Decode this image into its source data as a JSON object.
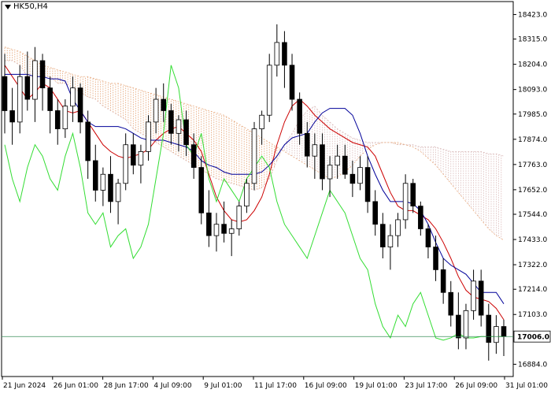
{
  "chart_data": {
    "type": "candlestick",
    "title": "HK50,H4",
    "current_price_label": "17006.0",
    "current_price": 17006.0,
    "ylim": [
      16830,
      18480
    ],
    "y_ticks": [
      "18423.0",
      "18315.0",
      "18204.0",
      "18093.0",
      "17985.0",
      "17874.0",
      "17763.0",
      "17652.0",
      "17544.0",
      "17433.0",
      "17322.0",
      "17214.0",
      "17103.0",
      "16884.0"
    ],
    "x_tick_labels": [
      "21 Jun 2024",
      "26 Jun 01:00",
      "28 Jun 17:00",
      "4 Jul 09:00",
      "9 Jul 01:00",
      "11 Jul 17:00",
      "16 Jul 09:00",
      "19 Jul 01:00",
      "23 Jul 17:00",
      "26 Jul 09:00",
      "31 Jul 01:00"
    ],
    "candles": [
      [
        18150,
        18250,
        17900,
        18000
      ],
      [
        18000,
        18100,
        17850,
        17950
      ],
      [
        17950,
        18200,
        17900,
        18150
      ],
      [
        18150,
        18260,
        18000,
        18050
      ],
      [
        18050,
        18280,
        17950,
        18220
      ],
      [
        18220,
        18250,
        18000,
        18100
      ],
      [
        18100,
        18150,
        17900,
        18000
      ],
      [
        18000,
        18050,
        17850,
        17920
      ],
      [
        17920,
        18050,
        17880,
        18020
      ],
      [
        18020,
        18150,
        17950,
        18100
      ],
      [
        18100,
        18120,
        17900,
        17950
      ],
      [
        17950,
        18000,
        17700,
        17780
      ],
      [
        17780,
        17850,
        17600,
        17650
      ],
      [
        17650,
        17750,
        17580,
        17720
      ],
      [
        17720,
        17800,
        17550,
        17600
      ],
      [
        17600,
        17700,
        17500,
        17680
      ],
      [
        17680,
        17900,
        17650,
        17850
      ],
      [
        17850,
        17900,
        17720,
        17760
      ],
      [
        17760,
        17850,
        17680,
        17820
      ],
      [
        17820,
        17980,
        17780,
        17950
      ],
      [
        17950,
        18100,
        17900,
        18050
      ],
      [
        18050,
        18120,
        17950,
        18000
      ],
      [
        18000,
        18030,
        17850,
        17900
      ],
      [
        17900,
        17980,
        17820,
        17960
      ],
      [
        17960,
        18000,
        17800,
        17850
      ],
      [
        17850,
        17900,
        17700,
        17750
      ],
      [
        17750,
        17800,
        17500,
        17550
      ],
      [
        17550,
        17650,
        17400,
        17450
      ],
      [
        17450,
        17550,
        17380,
        17500
      ],
      [
        17500,
        17600,
        17420,
        17460
      ],
      [
        17460,
        17520,
        17360,
        17480
      ],
      [
        17480,
        17600,
        17450,
        17580
      ],
      [
        17580,
        17700,
        17550,
        17680
      ],
      [
        17680,
        17950,
        17650,
        17920
      ],
      [
        17920,
        18000,
        17850,
        17980
      ],
      [
        17980,
        18250,
        17950,
        18200
      ],
      [
        18200,
        18380,
        18150,
        18300
      ],
      [
        18300,
        18350,
        18100,
        18200
      ],
      [
        18200,
        18250,
        18000,
        18050
      ],
      [
        18050,
        18080,
        17850,
        17900
      ],
      [
        17900,
        17950,
        17750,
        17800
      ],
      [
        17800,
        17900,
        17700,
        17850
      ],
      [
        17850,
        17900,
        17650,
        17700
      ],
      [
        17700,
        17800,
        17620,
        17760
      ],
      [
        17760,
        17850,
        17700,
        17800
      ],
      [
        17800,
        17850,
        17700,
        17720
      ],
      [
        17720,
        17780,
        17620,
        17680
      ],
      [
        17680,
        17800,
        17650,
        17750
      ],
      [
        17750,
        17800,
        17550,
        17600
      ],
      [
        17600,
        17650,
        17450,
        17500
      ],
      [
        17500,
        17550,
        17350,
        17400
      ],
      [
        17400,
        17500,
        17300,
        17450
      ],
      [
        17450,
        17550,
        17400,
        17520
      ],
      [
        17520,
        17720,
        17480,
        17680
      ],
      [
        17680,
        17700,
        17550,
        17580
      ],
      [
        17580,
        17600,
        17450,
        17480
      ],
      [
        17480,
        17500,
        17350,
        17400
      ],
      [
        17400,
        17450,
        17250,
        17300
      ],
      [
        17300,
        17350,
        17150,
        17200
      ],
      [
        17200,
        17250,
        17050,
        17100
      ],
      [
        17100,
        17200,
        16950,
        17000
      ],
      [
        17000,
        17150,
        16950,
        17120
      ],
      [
        17120,
        17300,
        17080,
        17250
      ],
      [
        17250,
        17300,
        17050,
        17100
      ],
      [
        17100,
        17150,
        16900,
        16980
      ],
      [
        16980,
        17100,
        16930,
        17050
      ],
      [
        17050,
        17080,
        16920,
        17006
      ]
    ],
    "series": [
      {
        "color": "#cc0000",
        "values": [
          18200,
          18150,
          18100,
          18050,
          18080,
          18120,
          18100,
          18050,
          18000,
          17990,
          18000,
          17950,
          17900,
          17850,
          17820,
          17800,
          17790,
          17800,
          17810,
          17830,
          17870,
          17900,
          17920,
          17930,
          17900,
          17870,
          17820,
          17720,
          17620,
          17560,
          17520,
          17510,
          17520,
          17560,
          17620,
          17720,
          17850,
          17950,
          18020,
          18050,
          18020,
          17980,
          17950,
          17920,
          17900,
          17880,
          17860,
          17850,
          17840,
          17800,
          17720,
          17640,
          17580,
          17560,
          17560,
          17540,
          17520,
          17480,
          17420,
          17350,
          17270,
          17210,
          17180,
          17170,
          17160,
          17130,
          17080
        ]
      },
      {
        "color": "#000099",
        "values": [
          18160,
          18160,
          18160,
          18160,
          18150,
          18150,
          18140,
          18140,
          18130,
          18050,
          18000,
          17950,
          17930,
          17930,
          17930,
          17930,
          17920,
          17900,
          17880,
          17870,
          17870,
          17870,
          17860,
          17850,
          17840,
          17820,
          17780,
          17760,
          17750,
          17730,
          17720,
          17720,
          17720,
          17720,
          17730,
          17760,
          17800,
          17850,
          17880,
          17890,
          17900,
          17950,
          17990,
          18010,
          18010,
          18010,
          17980,
          17900,
          17800,
          17720,
          17650,
          17600,
          17600,
          17600,
          17590,
          17560,
          17500,
          17420,
          17350,
          17320,
          17300,
          17280,
          17240,
          17200,
          17200,
          17200,
          17150
        ]
      },
      {
        "color": "#33dd33",
        "values": [
          17850,
          17700,
          17600,
          17750,
          17850,
          17800,
          17700,
          17650,
          17800,
          17900,
          17750,
          17550,
          17500,
          17550,
          17400,
          17450,
          17480,
          17350,
          17400,
          17500,
          17700,
          17900,
          18200,
          18100,
          17850,
          17800,
          17900,
          17700,
          17600,
          17700,
          17650,
          17600,
          17700,
          17750,
          17800,
          17750,
          17600,
          17500,
          17450,
          17400,
          17350,
          17450,
          17550,
          17650,
          17600,
          17550,
          17450,
          17350,
          17300,
          17150,
          17050,
          17000,
          17100,
          17050,
          17150,
          17200,
          17100,
          17000,
          16990,
          17000,
          17020,
          17000,
          17000,
          17006,
          17006,
          17006,
          17006
        ]
      }
    ],
    "cloud": {
      "colors": [
        "#d9b8b8",
        "#e4a070"
      ],
      "span_a": [
        18220,
        18220,
        18200,
        18150,
        18150,
        18150,
        18150,
        18120,
        18120,
        18100,
        18080,
        18060,
        18050,
        18020,
        18000,
        17980,
        17960,
        17920,
        17900,
        17880,
        17860,
        17840,
        17820,
        17800,
        17780,
        17760,
        17740,
        17720,
        17700,
        17690,
        17680,
        17670,
        17660,
        17650,
        17660,
        17700,
        17780,
        17850,
        17900,
        17960,
        18000,
        18020,
        17980,
        17950,
        17920,
        17900,
        17880,
        17870,
        17860,
        17860,
        17860,
        17860,
        17850,
        17850,
        17850,
        17840,
        17840,
        17840,
        17830,
        17820,
        17820,
        17820,
        17820,
        17820,
        17810,
        17810,
        17800
      ],
      "span_b": [
        18280,
        18270,
        18260,
        18240,
        18220,
        18200,
        18190,
        18180,
        18170,
        18160,
        18150,
        18150,
        18140,
        18130,
        18120,
        18120,
        18110,
        18100,
        18090,
        18080,
        18070,
        18060,
        18050,
        18040,
        18030,
        18020,
        18010,
        18000,
        17990,
        17980,
        17960,
        17940,
        17920,
        17900,
        17880,
        17860,
        17840,
        17820,
        17800,
        17780,
        17760,
        17740,
        17720,
        17700,
        17710,
        17730,
        17760,
        17800,
        17830,
        17850,
        17860,
        17860,
        17860,
        17850,
        17840,
        17820,
        17790,
        17760,
        17720,
        17680,
        17640,
        17600,
        17560,
        17520,
        17480,
        17450,
        17430
      ]
    }
  }
}
